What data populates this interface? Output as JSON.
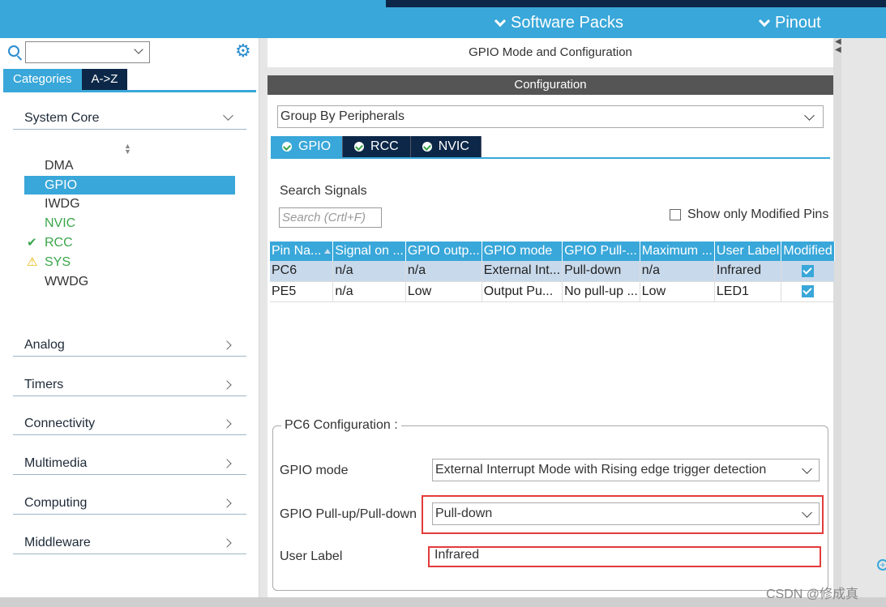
{
  "header": {
    "tabs": [
      {
        "label": "Software Packs"
      },
      {
        "label": "Pinout"
      }
    ]
  },
  "left": {
    "search_value": "",
    "tabs": [
      "Categories",
      "A->Z"
    ],
    "groups": [
      {
        "label": "System Core",
        "expanded": true
      },
      {
        "label": "Analog"
      },
      {
        "label": "Timers"
      },
      {
        "label": "Connectivity"
      },
      {
        "label": "Multimedia"
      },
      {
        "label": "Computing"
      },
      {
        "label": "Middleware"
      }
    ],
    "items": [
      {
        "label": "DMA",
        "icon": ""
      },
      {
        "label": "GPIO",
        "icon": "",
        "selected": true
      },
      {
        "label": "IWDG",
        "icon": ""
      },
      {
        "label": "NVIC",
        "icon": ""
      },
      {
        "label": "RCC",
        "icon": "check-icon"
      },
      {
        "label": "SYS",
        "icon": "warning-icon"
      },
      {
        "label": "WWDG",
        "icon": ""
      }
    ]
  },
  "main": {
    "title": "GPIO Mode and Configuration",
    "config_header": "Configuration",
    "group_by": "Group By Peripherals",
    "periph_tabs": [
      "GPIO",
      "RCC",
      "NVIC"
    ],
    "search_label": "Search Signals",
    "search_placeholder": "Search (Crtl+F)",
    "show_modified_label": "Show only Modified Pins",
    "columns": [
      "Pin Na...",
      "Signal on ...",
      "GPIO outp...",
      "GPIO mode",
      "GPIO Pull-...",
      "Maximum ...",
      "User Label",
      "Modified"
    ],
    "rows": [
      [
        "PC6",
        "n/a",
        "n/a",
        "External Int...",
        "Pull-down",
        "n/a",
        "Infrared",
        "true"
      ],
      [
        "PE5",
        "n/a",
        "Low",
        "Output Pu...",
        "No pull-up ...",
        "Low",
        "LED1",
        "true"
      ]
    ],
    "pin_config": {
      "legend": "PC6 Configuration :",
      "gpio_mode_label": "GPIO mode",
      "gpio_mode_value": "External Interrupt Mode with Rising edge trigger detection",
      "pull_label": "GPIO Pull-up/Pull-down",
      "pull_value": "Pull-down",
      "user_label_label": "User Label",
      "user_label_value": "Infrared"
    }
  },
  "watermark": "CSDN @修成真",
  "accent_color": "#39a7d9",
  "highlight_color": "#e33b3b"
}
